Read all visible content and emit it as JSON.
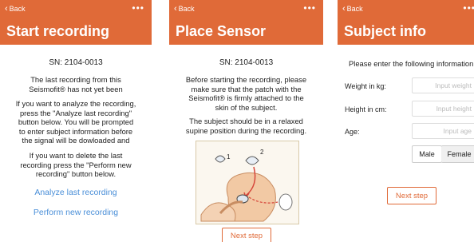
{
  "screen1": {
    "back": "Back",
    "more": "•••",
    "title": "Start recording",
    "sn": "SN: 2104-0013",
    "para1_line1": "The last recording from this",
    "para1_line2": "Seismofit® has not yet been",
    "para2_line1": "If you want to analyze the recording,",
    "para2_line2": "press the \"Analyze last recording\"",
    "para2_line3": "button below. You will be prompted",
    "para2_line4": "to enter subject information before",
    "para2_line5": "the signal will be dowloaded and",
    "para3_line1": "If you want to delete the last",
    "para3_line2": "recording press the \"Perform new",
    "para3_line3": "recording\" button below.",
    "analyze": "Analyze last recording",
    "perform": "Perform new recording"
  },
  "screen2": {
    "back": "Back",
    "more": "•••",
    "title": "Place Sensor",
    "sn": "SN: 2104-0013",
    "para1_line1": "Before starting the recording, please",
    "para1_line2": "make sure that the patch with the",
    "para1_line3": "Seismofit® is firmly attached to the",
    "para1_line4": "skin of the subject.",
    "para2_line1": "The subject should be in a relaxed",
    "para2_line2": "supine position during the recording.",
    "illus_label1": "1",
    "illus_label2": "2",
    "next": "Next step"
  },
  "screen3": {
    "back": "Back",
    "more": "•••",
    "title": "Subject info",
    "prompt": "Please enter the following information",
    "weight_label": "Weight in kg:",
    "weight_placeholder": "Input weight",
    "height_label": "Height in cm:",
    "height_placeholder": "Input height",
    "age_label": "Age:",
    "age_placeholder": "Input age",
    "male": "Male",
    "female": "Female",
    "next": "Next step"
  },
  "colors": {
    "accent": "#e06a38",
    "link": "#4a8fd8"
  }
}
